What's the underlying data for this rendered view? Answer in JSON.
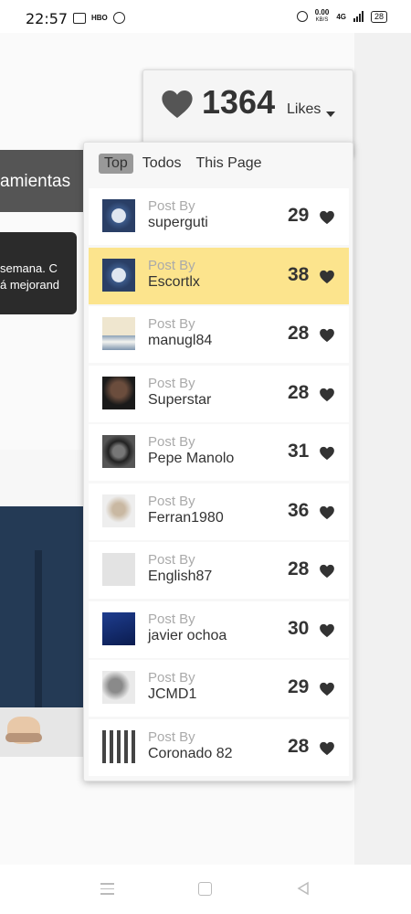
{
  "status_bar": {
    "time": "22:57",
    "hbo": "HBO",
    "speed_value": "0.00",
    "speed_unit": "KB/S",
    "network": "4G",
    "battery": "28"
  },
  "background": {
    "tools_label": "amientas",
    "notice_line1": "semana. C",
    "notice_line2": "á mejorand"
  },
  "likes": {
    "count": "1364",
    "label": "Likes",
    "icon": "heart-icon",
    "color": "#555555"
  },
  "tabs": [
    {
      "label": "Top",
      "active": true
    },
    {
      "label": "Todos",
      "active": false
    },
    {
      "label": "This Page",
      "active": false
    }
  ],
  "posts": [
    {
      "post_by": "Post By",
      "author": "superguti",
      "likes": "29",
      "highlight": false,
      "avatar": "watch-avatar"
    },
    {
      "post_by": "Post By",
      "author": "Escortlx",
      "likes": "38",
      "highlight": true,
      "avatar": "watch-avatar"
    },
    {
      "post_by": "Post By",
      "author": "manugl84",
      "likes": "28",
      "highlight": false,
      "avatar": "wave-painting-avatar"
    },
    {
      "post_by": "Post By",
      "author": "Superstar",
      "likes": "28",
      "highlight": false,
      "avatar": "man-sunglasses-avatar"
    },
    {
      "post_by": "Post By",
      "author": "Pepe Manolo",
      "likes": "31",
      "highlight": false,
      "avatar": "watch-dark-avatar"
    },
    {
      "post_by": "Post By",
      "author": "Ferran1980",
      "likes": "36",
      "highlight": false,
      "avatar": "portrait-sketch-avatar"
    },
    {
      "post_by": "Post By",
      "author": "English87",
      "likes": "28",
      "highlight": false,
      "avatar": "default-user-avatar"
    },
    {
      "post_by": "Post By",
      "author": "javier ochoa",
      "likes": "30",
      "highlight": false,
      "avatar": "blue-photo-avatar"
    },
    {
      "post_by": "Post By",
      "author": "JCMD1",
      "likes": "29",
      "highlight": false,
      "avatar": "man-portrait-avatar"
    },
    {
      "post_by": "Post By",
      "author": "Coronado 82",
      "likes": "28",
      "highlight": false,
      "avatar": "watches-grid-avatar"
    }
  ],
  "colors": {
    "highlight": "#fce48d",
    "heart": "#333333"
  }
}
